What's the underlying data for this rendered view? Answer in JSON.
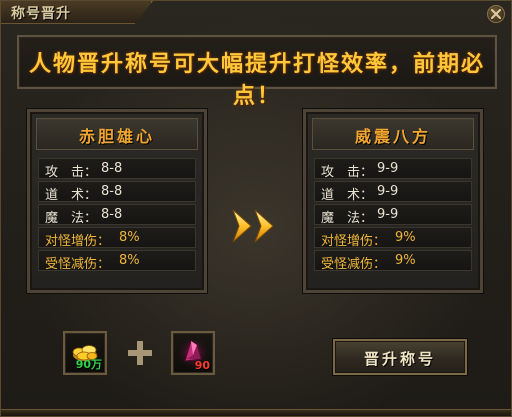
{
  "window": {
    "title": "称号晋升"
  },
  "banner": {
    "text": "人物晋升称号可大幅提升打怪效率，前期必点！"
  },
  "current_title": {
    "name": "赤胆雄心",
    "stats": [
      {
        "label": "攻　击：",
        "value": "8-8",
        "highlight": false
      },
      {
        "label": "道　术：",
        "value": "8-8",
        "highlight": false
      },
      {
        "label": "魔　法：",
        "value": "8-8",
        "highlight": false
      },
      {
        "label": "对怪增伤：",
        "value": "8%",
        "highlight": true
      },
      {
        "label": "受怪减伤：",
        "value": "8%",
        "highlight": true
      }
    ]
  },
  "next_title": {
    "name": "威震八方",
    "stats": [
      {
        "label": "攻　击：",
        "value": "9-9",
        "highlight": false
      },
      {
        "label": "道　术：",
        "value": "9-9",
        "highlight": false
      },
      {
        "label": "魔　法：",
        "value": "9-9",
        "highlight": false
      },
      {
        "label": "对怪增伤：",
        "value": "9%",
        "highlight": true
      },
      {
        "label": "受怪减伤：",
        "value": "9%",
        "highlight": true
      }
    ]
  },
  "cost": {
    "gold": {
      "count": "90万",
      "icon": "gold-ingot-icon"
    },
    "gem": {
      "count": "90",
      "icon": "crystal-gem-icon"
    }
  },
  "actions": {
    "promote_label": "晋升称号"
  },
  "colors": {
    "accent_gold": "#ffc83a",
    "title_orange": "#f2a630",
    "stat_highlight": "#f0b63a",
    "count_green": "#2cd24a",
    "count_red": "#ff3b2f"
  }
}
